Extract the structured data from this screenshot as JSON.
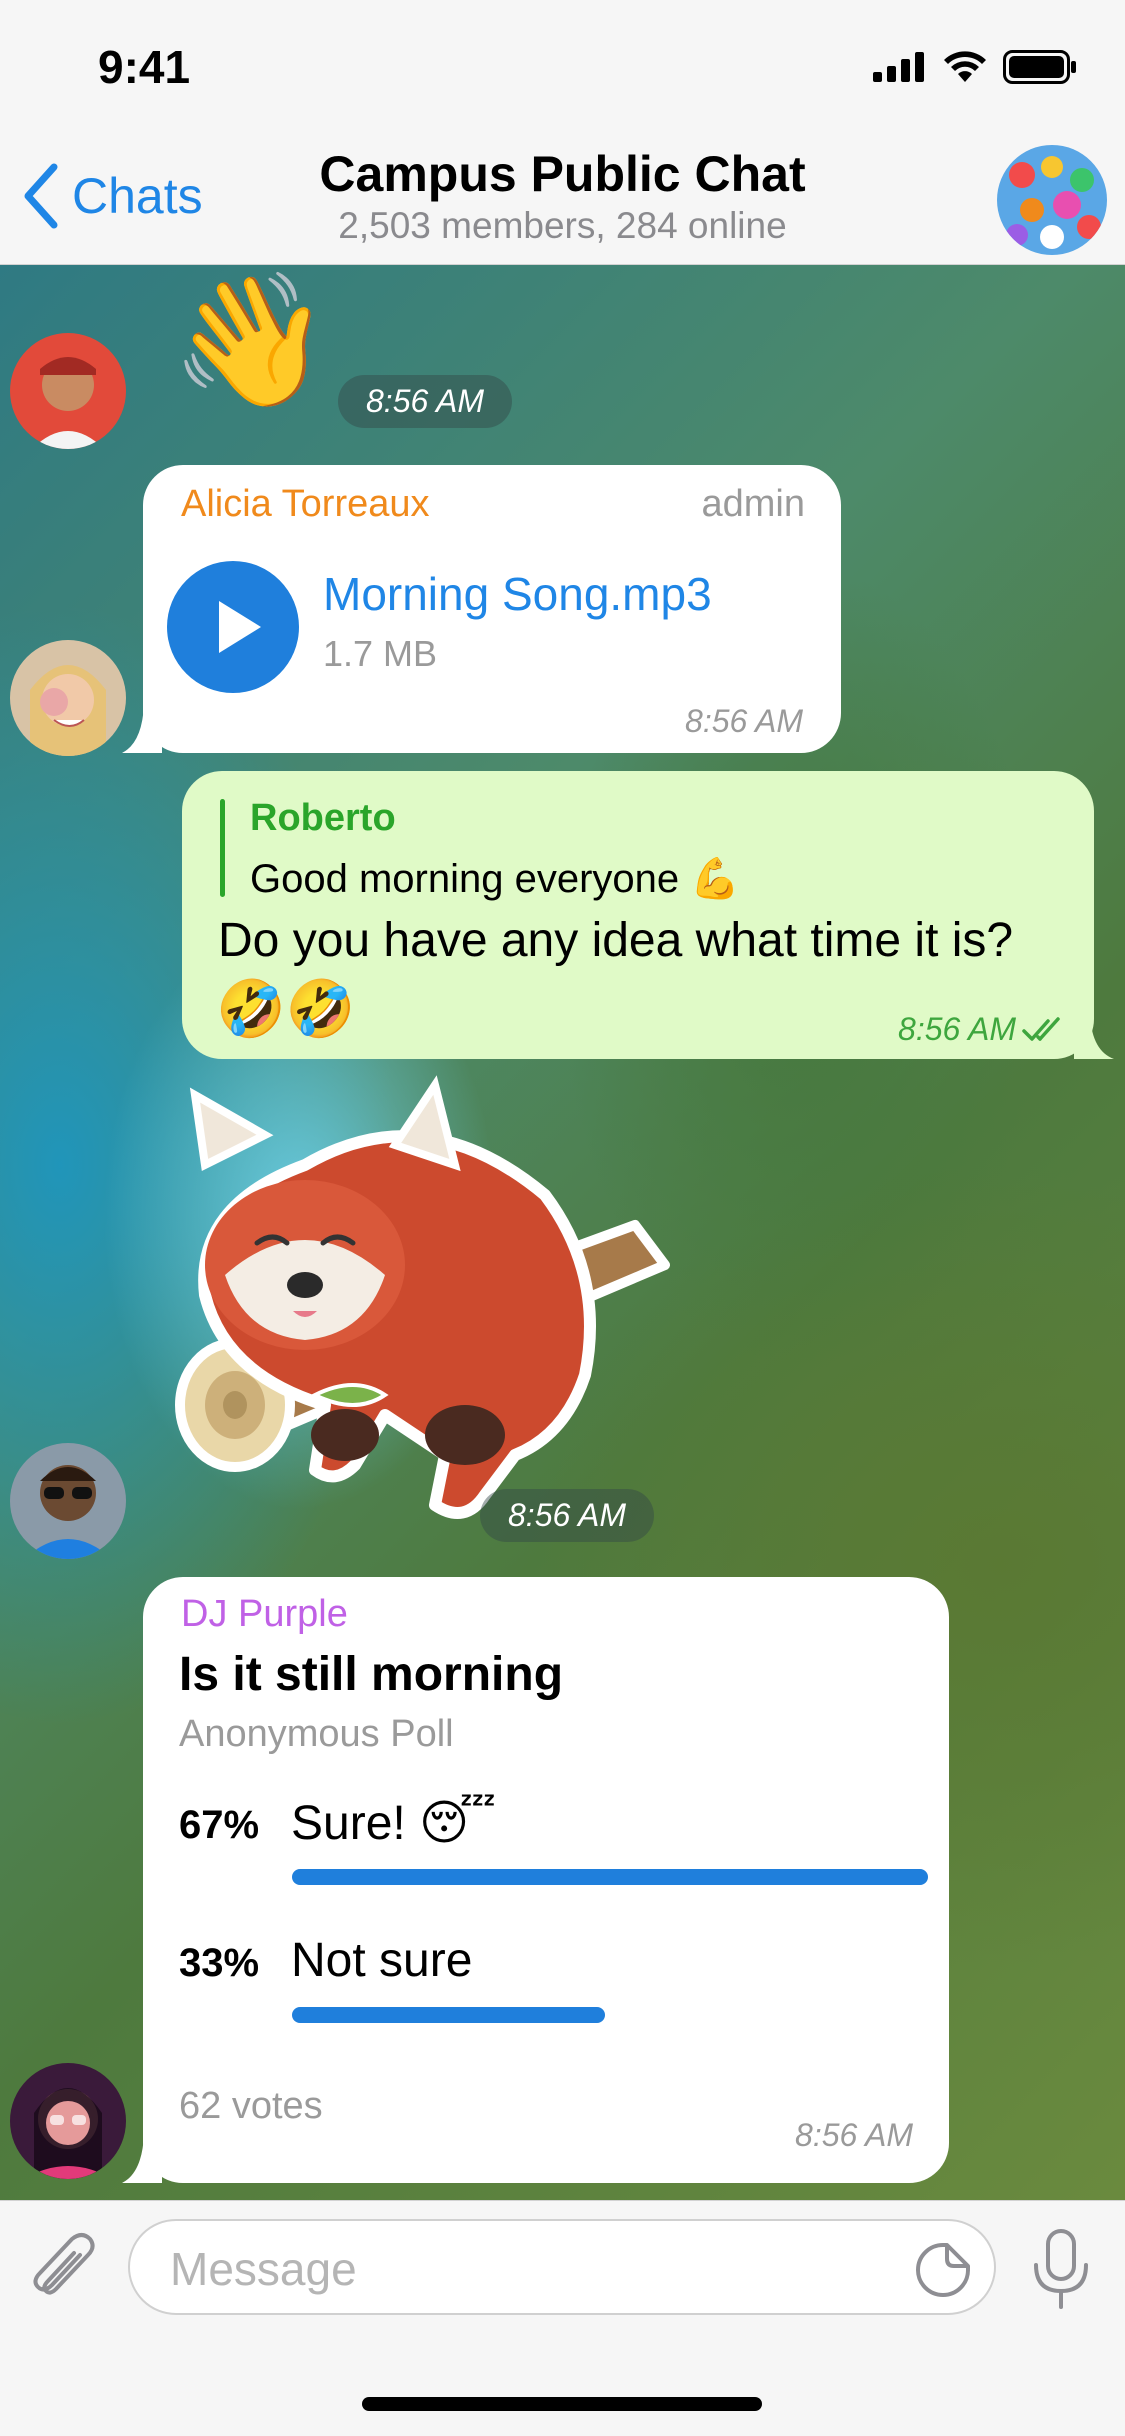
{
  "status_bar": {
    "time": "9:41"
  },
  "nav": {
    "back_label": "Chats",
    "title": "Campus Public Chat",
    "subtitle": "2,503 members, 284 online"
  },
  "messages": {
    "wave": {
      "emoji": "👋",
      "time": "8:56 AM"
    },
    "audio": {
      "sender": "Alicia Torreaux",
      "role": "admin",
      "file_name": "Morning Song.mp3",
      "file_size": "1.7 MB",
      "time": "8:56 AM"
    },
    "outgoing": {
      "reply_to_name": "Roberto",
      "reply_to_text": "Good morning everyone 💪",
      "text": "Do you have any idea what time it is?",
      "emojis": "🤣🤣",
      "time": "8:56 AM"
    },
    "sticker": {
      "time": "8:56 AM"
    },
    "poll": {
      "sender": "DJ Purple",
      "question": "Is it still morning",
      "type": "Anonymous Poll",
      "options": [
        {
          "percent_label": "67%",
          "label": "Sure! 😴",
          "fraction": 0.67
        },
        {
          "percent_label": "33%",
          "label": "Not sure",
          "fraction": 0.33
        }
      ],
      "votes": "62 votes",
      "time": "8:56 AM"
    }
  },
  "input": {
    "placeholder": "Message"
  },
  "colors": {
    "accent": "#1f86e6",
    "outgoing_bubble": "#e0fac7",
    "alicia": "#f08a1c",
    "roberto": "#2aa52a",
    "dj_purple": "#c061e6",
    "poll_bar": "#1f7fdc"
  },
  "icons": [
    "back-chevron-icon",
    "signal-icon",
    "wifi-icon",
    "battery-icon",
    "play-icon",
    "double-check-icon",
    "attach-icon",
    "sticker-icon",
    "microphone-icon"
  ]
}
